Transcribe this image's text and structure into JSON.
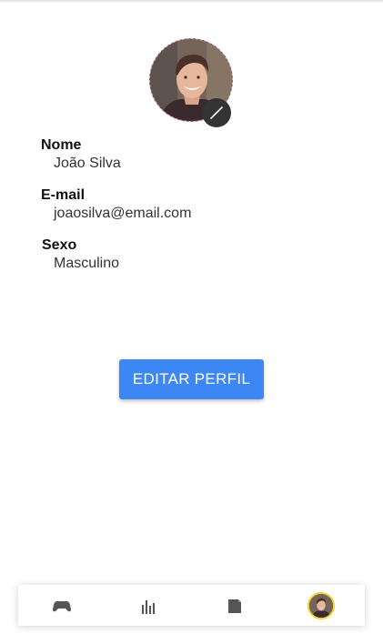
{
  "profile": {
    "fields": [
      {
        "label": "Nome",
        "value": "João Silva"
      },
      {
        "label": "E-mail",
        "value": "joaosilva@email.com"
      },
      {
        "label": "Sexo",
        "value": "Masculino"
      }
    ],
    "edit_button_label": "EDITAR PERFIL"
  },
  "bottom_nav": {
    "items": [
      {
        "icon": "gamepad-icon"
      },
      {
        "icon": "bar-chart-icon"
      },
      {
        "icon": "book-icon"
      },
      {
        "icon": "profile-avatar",
        "active_ring_color": "#f3d233"
      }
    ]
  },
  "colors": {
    "primary": "#3d87f5",
    "nav_icon": "#555555",
    "edit_badge": "#333333"
  }
}
